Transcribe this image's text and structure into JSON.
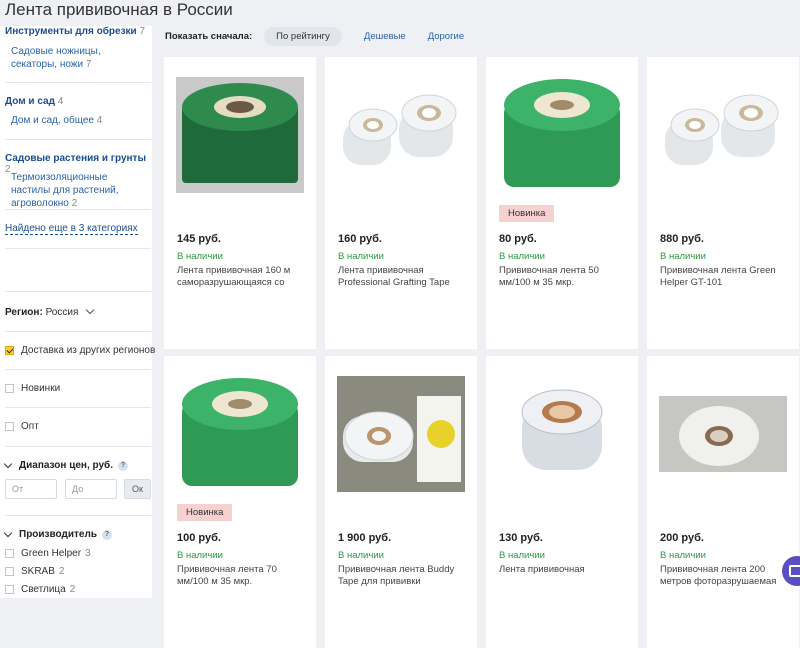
{
  "page": {
    "title": "Лента прививочная в России"
  },
  "sidebar": {
    "categories": [
      {
        "title": "Инструменты для обрезки",
        "count": "7",
        "sub": [
          {
            "label": "Садовые ножницы, секаторы, ножи",
            "count": "7"
          }
        ]
      },
      {
        "title": "Дом и сад",
        "count": "4",
        "sub": [
          {
            "label": "Дом и сад, общее",
            "count": "4"
          }
        ]
      },
      {
        "title": "Садовые растения и грунты",
        "count": "2",
        "sub": [
          {
            "label": "Термоизоляционные настилы для растений, агроволокно",
            "count": "2"
          }
        ]
      }
    ],
    "more_link": "Найдено еще в 3 категориях",
    "region": {
      "label": "Регион:",
      "value": "Россия"
    },
    "filters": [
      {
        "label": "Доставка из других регионов",
        "checked": true
      },
      {
        "label": "Новинки",
        "checked": false
      },
      {
        "label": "Опт",
        "checked": false
      }
    ],
    "price_range": {
      "title": "Диапазон цен, руб.",
      "help": "?",
      "from_placeholder": "От",
      "to_placeholder": "До",
      "ok_label": "Ок"
    },
    "manufacturer": {
      "title": "Производитель",
      "help": "?",
      "items": [
        {
          "label": "Green Helper",
          "count": "3"
        },
        {
          "label": "SKRAB",
          "count": "2"
        },
        {
          "label": "Светлица",
          "count": "2"
        }
      ]
    }
  },
  "sort": {
    "label": "Показать сначала:",
    "options": [
      {
        "label": "По рейтингу",
        "active": true
      },
      {
        "label": "Дешевые",
        "active": false
      },
      {
        "label": "Дорогие",
        "active": false
      }
    ]
  },
  "products": [
    {
      "price": "145 руб.",
      "stock": "В наличии",
      "name": "Лента прививочная 160 м саморазрушающаяся со",
      "badge": "",
      "image": "green-roll-dark"
    },
    {
      "price": "160 руб.",
      "stock": "В наличии",
      "name": "Лента прививочная Professional Grafting Tape",
      "badge": "",
      "image": "two-clear-rolls"
    },
    {
      "price": "80 руб.",
      "stock": "В наличии",
      "name": "Прививочная лента 50 мм/100 м 35 мкр.",
      "badge": "Новинка",
      "image": "green-roll-large"
    },
    {
      "price": "880 руб.",
      "stock": "В наличии",
      "name": "Прививочная лента Green Helper GT-101",
      "badge": "",
      "image": "two-clear-rolls"
    },
    {
      "price": "100 руб.",
      "stock": "В наличии",
      "name": "Прививочная лента 70 мм/100 м 35 мкр.",
      "badge": "Новинка",
      "image": "green-roll-large"
    },
    {
      "price": "1 900 руб.",
      "stock": "В наличии",
      "name": "Прививочная лента Buddy Tape для прививки",
      "badge": "",
      "image": "clear-roll-with-box"
    },
    {
      "price": "130 руб.",
      "stock": "В наличии",
      "name": "Лента прививочная",
      "badge": "",
      "image": "clear-roll-brown-core"
    },
    {
      "price": "200 руб.",
      "stock": "В наличии",
      "name": "Прививочная лента 200 метров фоторазрушаемая",
      "badge": "",
      "image": "clear-roll-grey-bg"
    }
  ],
  "colors": {
    "link": "#2a63a8",
    "stock": "#2a9a3e",
    "badge": "#f7d0d0",
    "accent": "#5a4fc0"
  }
}
